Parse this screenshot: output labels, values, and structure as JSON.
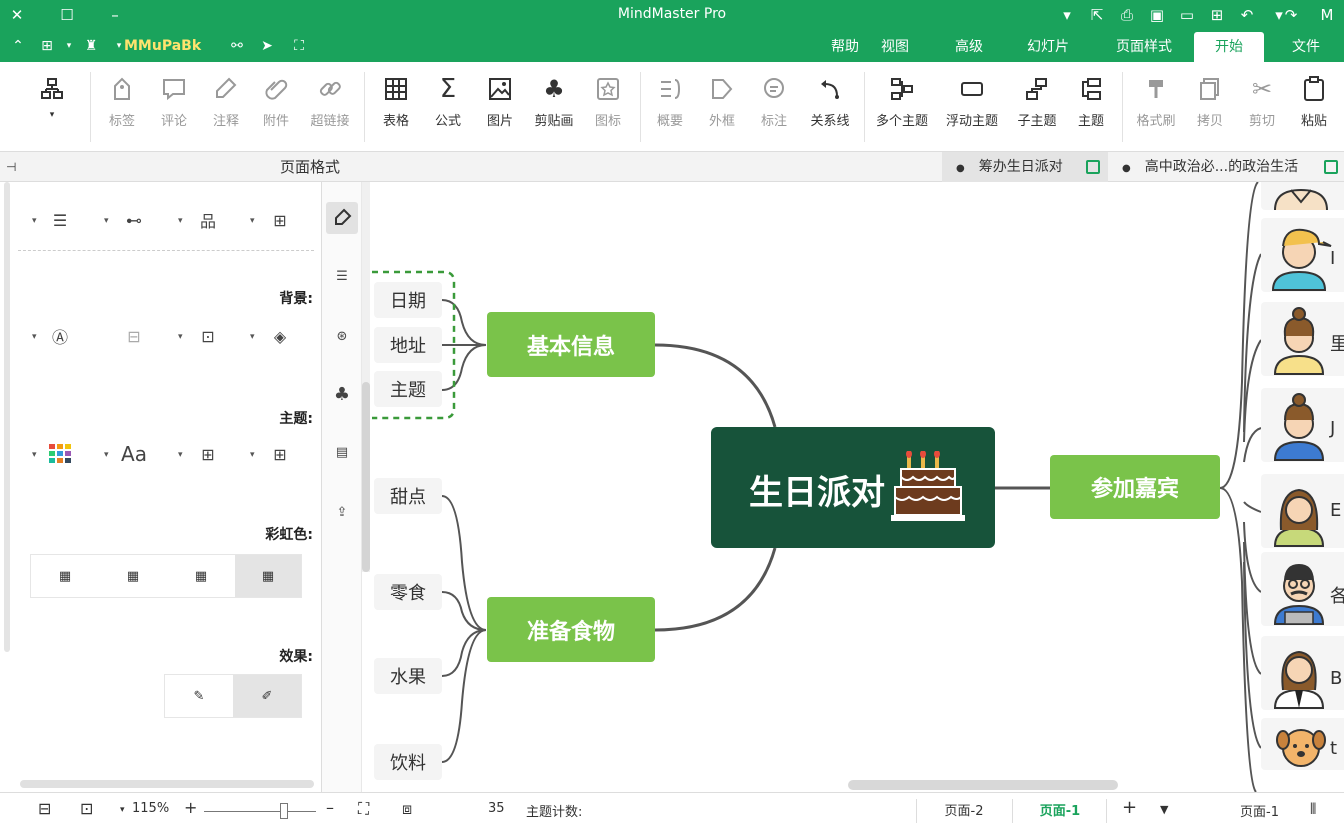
{
  "app": {
    "title": "MindMaster Pro"
  },
  "menu": {
    "tabs": [
      "文件",
      "开始",
      "页面样式",
      "幻灯片",
      "高级",
      "视图",
      "帮助"
    ],
    "active": "开始",
    "user_label": "MMuPaBk"
  },
  "ribbon": {
    "paste": "粘贴",
    "cut": "剪切",
    "copy": "拷贝",
    "format_painter": "格式刷",
    "topic": "主题",
    "subtopic": "子主题",
    "floating_topic": "浮动主题",
    "multi_topic": "多个主题",
    "relationship": "关系线",
    "callout": "标注",
    "boundary": "外框",
    "summary": "概要",
    "icon": "图标",
    "clipart": "剪贴画",
    "picture": "图片",
    "formula": "公式",
    "table": "表格",
    "hyperlink": "超链接",
    "attachment": "附件",
    "note": "注释",
    "comment": "评论",
    "tag": "标签"
  },
  "doc_tabs": [
    {
      "label": "高中政治必...的政治生活",
      "active": false
    },
    {
      "label": "筹办生日派对",
      "active": true
    }
  ],
  "panel": {
    "title": "页面格式",
    "background_label": "背景:",
    "theme_label": "主题:",
    "rainbow_label": "彩虹色:",
    "effect_label": "效果:"
  },
  "mindmap": {
    "central": "生日派对",
    "branches": [
      {
        "label": "基本信息",
        "children": [
          "日期",
          "地址",
          "主题"
        ]
      },
      {
        "label": "准备食物",
        "children": [
          "甜点",
          "零食",
          "水果",
          "饮料"
        ]
      },
      {
        "label": "参加嘉宾",
        "children": []
      }
    ],
    "cut_labels": [
      "I",
      "里",
      "J",
      "E",
      "各",
      "B",
      "t"
    ]
  },
  "status": {
    "zoom": "115%",
    "topic_count_label": "主题计数:",
    "topic_count": "35",
    "page_tabs": [
      "页面-2",
      "页面-1"
    ],
    "active_page": "页面-1",
    "page_label": "页面-1"
  },
  "colors": {
    "brand": "#1aa35c",
    "central_node": "#17533a",
    "branch_node": "#7ac34a",
    "leaf_node": "#f4f4f4"
  }
}
